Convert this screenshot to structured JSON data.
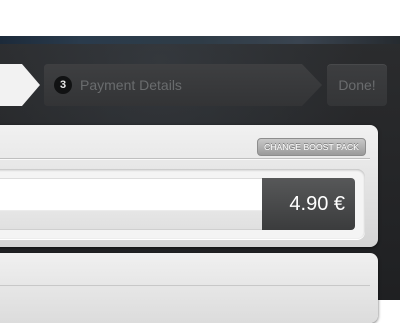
{
  "steps": {
    "current": {
      "number": "3",
      "label": "Payment Details"
    },
    "done_label": "Done!"
  },
  "boost_pack": {
    "change_button_label": "CHANGE BOOST PACK",
    "price": "4.90 €"
  },
  "colors": {
    "background_dark": "#232426",
    "step_active": "#f2f2f2",
    "step_inactive": "#3a3b3d",
    "step_text_inactive": "#6a6c6e",
    "panel_light": "#e6e6e6",
    "price_box": "#484949"
  }
}
